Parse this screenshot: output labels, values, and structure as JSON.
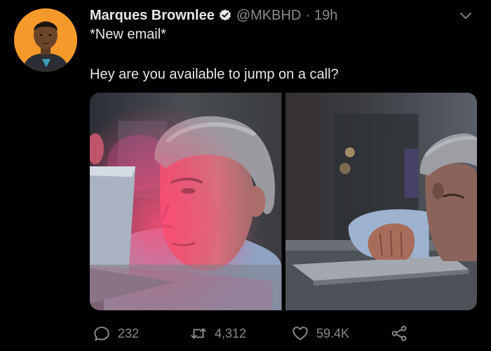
{
  "author": {
    "name": "Marques Brownlee",
    "handle": "@MKBHD",
    "separator": "·",
    "time": "19h"
  },
  "tweet": {
    "line1": "*New email*",
    "line2": "Hey are you available to jump on a call?"
  },
  "media": {
    "count": 2,
    "photos": [
      "photo-man-at-laptop-pink-light",
      "photo-man-peeking-over-laptop"
    ]
  },
  "stats": {
    "replies": "232",
    "retweets": "4,312",
    "likes": "59.4K"
  },
  "icons": {
    "verified": "verified-badge-icon",
    "menu": "chevron-down-icon",
    "reply": "reply-icon",
    "retweet": "retweet-icon",
    "like": "heart-icon",
    "share": "share-icon"
  },
  "colors": {
    "background": "#000000",
    "primary_text": "#e8e8e8",
    "secondary_text": "#8b8b8b",
    "avatar_bg": "#f59a2a"
  }
}
